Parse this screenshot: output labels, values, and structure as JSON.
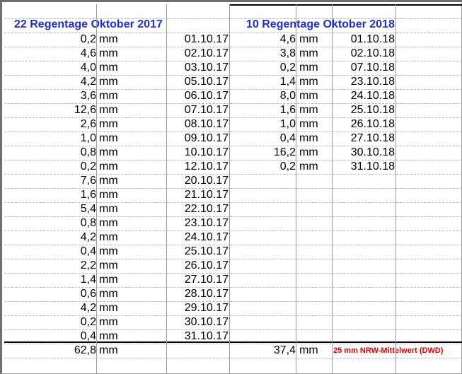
{
  "left": {
    "header": "22 Regentage Oktober 2017",
    "rows": [
      {
        "value": "0,2",
        "unit": "mm",
        "date": "01.10.17"
      },
      {
        "value": "4,6",
        "unit": "mm",
        "date": "02.10.17"
      },
      {
        "value": "4,0",
        "unit": "mm",
        "date": "03.10.17"
      },
      {
        "value": "4,2",
        "unit": "mm",
        "date": "05.10.17"
      },
      {
        "value": "3,6",
        "unit": "mm",
        "date": "06.10.17"
      },
      {
        "value": "12,6",
        "unit": "mm",
        "date": "07.10.17"
      },
      {
        "value": "2,6",
        "unit": "mm",
        "date": "08.10.17"
      },
      {
        "value": "1,0",
        "unit": "mm",
        "date": "09.10.17"
      },
      {
        "value": "0,8",
        "unit": "mm",
        "date": "10.10.17"
      },
      {
        "value": "0,2",
        "unit": "mm",
        "date": "12.10.17"
      },
      {
        "value": "7,6",
        "unit": "mm",
        "date": "20.10.17"
      },
      {
        "value": "1,6",
        "unit": "mm",
        "date": "21.10.17"
      },
      {
        "value": "5,4",
        "unit": "mm",
        "date": "22.10.17"
      },
      {
        "value": "0,8",
        "unit": "mm",
        "date": "23.10.17"
      },
      {
        "value": "4,2",
        "unit": "mm",
        "date": "24.10.17"
      },
      {
        "value": "0,4",
        "unit": "mm",
        "date": "25.10.17"
      },
      {
        "value": "2,2",
        "unit": "mm",
        "date": "26.10.17"
      },
      {
        "value": "1,4",
        "unit": "mm",
        "date": "27.10.17"
      },
      {
        "value": "0,6",
        "unit": "mm",
        "date": "28.10.17"
      },
      {
        "value": "4,2",
        "unit": "mm",
        "date": "29.10.17"
      },
      {
        "value": "0,2",
        "unit": "mm",
        "date": "30.10.17"
      },
      {
        "value": "0,4",
        "unit": "mm",
        "date": "31.10.17"
      }
    ],
    "total": {
      "value": "62,8",
      "unit": "mm"
    }
  },
  "right": {
    "header": "10 Regentage Oktober 2018",
    "rows": [
      {
        "value": "4,6",
        "unit": "mm",
        "date": "01.10.18"
      },
      {
        "value": "3,8",
        "unit": "mm",
        "date": "02.10.18"
      },
      {
        "value": "0,2",
        "unit": "mm",
        "date": "07.10.18"
      },
      {
        "value": "1,4",
        "unit": "mm",
        "date": "23.10.18"
      },
      {
        "value": "8,0",
        "unit": "mm",
        "date": "24.10.18"
      },
      {
        "value": "1,6",
        "unit": "mm",
        "date": "25.10.18"
      },
      {
        "value": "1,0",
        "unit": "mm",
        "date": "26.10.18"
      },
      {
        "value": "0,4",
        "unit": "mm",
        "date": "27.10.18"
      },
      {
        "value": "16,2",
        "unit": "mm",
        "date": "30.10.18"
      },
      {
        "value": "0,2",
        "unit": "mm",
        "date": "31.10.18"
      }
    ],
    "total": {
      "value": "37,4",
      "unit": "mm"
    }
  },
  "note": "25 mm NRW-Mittelwert (DWD)",
  "colors": {
    "header": "#1f2ecc",
    "note": "#e00000"
  }
}
